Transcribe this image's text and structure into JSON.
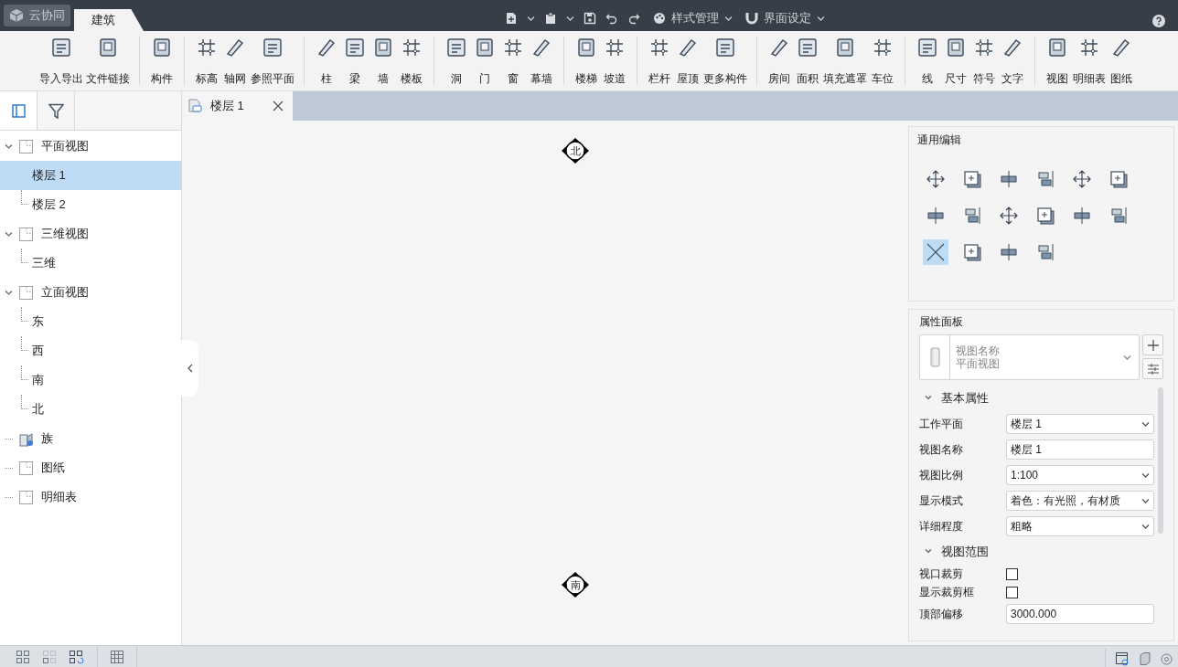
{
  "app_button": {
    "label": "云协同"
  },
  "ribbon_tabs": [
    {
      "label": "建筑",
      "selected": true
    }
  ],
  "quick_menus": [
    {
      "label": "样式管理"
    },
    {
      "label": "界面设定"
    }
  ],
  "ribbon_groups": [
    {
      "buttons": [
        {
          "label": "导入导出"
        },
        {
          "label": "文件链接"
        }
      ]
    },
    {
      "buttons": [
        {
          "label": "构件"
        }
      ]
    },
    {
      "buttons": [
        {
          "label": "标高"
        },
        {
          "label": "轴网"
        },
        {
          "label": "参照平面"
        }
      ]
    },
    {
      "buttons": [
        {
          "label": "柱"
        },
        {
          "label": "梁"
        },
        {
          "label": "墙"
        },
        {
          "label": "楼板"
        }
      ]
    },
    {
      "buttons": [
        {
          "label": "洞"
        },
        {
          "label": "门"
        },
        {
          "label": "窗"
        },
        {
          "label": "幕墙"
        }
      ]
    },
    {
      "buttons": [
        {
          "label": "楼梯"
        },
        {
          "label": "坡道"
        }
      ]
    },
    {
      "buttons": [
        {
          "label": "栏杆"
        },
        {
          "label": "屋顶"
        },
        {
          "label": "更多构件"
        }
      ]
    },
    {
      "buttons": [
        {
          "label": "房间"
        },
        {
          "label": "面积"
        },
        {
          "label": "填充遮罩"
        },
        {
          "label": "车位"
        }
      ]
    },
    {
      "buttons": [
        {
          "label": "线"
        },
        {
          "label": "尺寸"
        },
        {
          "label": "符号"
        },
        {
          "label": "文字"
        }
      ]
    },
    {
      "buttons": [
        {
          "label": "视图"
        },
        {
          "label": "明细表"
        },
        {
          "label": "图纸"
        }
      ]
    }
  ],
  "sidebar": {
    "tabs": [
      {
        "selected": true
      },
      {
        "selected": false
      }
    ],
    "tree": [
      {
        "label": "平面视图",
        "kind": "view",
        "expanded": true,
        "selected": false,
        "children": [
          {
            "label": "楼层 1",
            "selected": true
          },
          {
            "label": "楼层 2",
            "selected": false
          }
        ]
      },
      {
        "label": "三维视图",
        "kind": "view",
        "expanded": true,
        "selected": false,
        "children": [
          {
            "label": "三维",
            "selected": false
          }
        ]
      },
      {
        "label": "立面视图",
        "kind": "view",
        "expanded": true,
        "selected": false,
        "children": [
          {
            "label": "东",
            "selected": false
          },
          {
            "label": "西",
            "selected": false
          },
          {
            "label": "南",
            "selected": false
          },
          {
            "label": "北",
            "selected": false
          }
        ]
      },
      {
        "label": "族",
        "kind": "family",
        "selected": false
      },
      {
        "label": "图纸",
        "kind": "view",
        "selected": false
      },
      {
        "label": "明细表",
        "kind": "view",
        "selected": false
      }
    ]
  },
  "document_tabs": [
    {
      "label": "楼层 1",
      "selected": true
    }
  ],
  "canvas": {
    "markers": [
      {
        "label": "北",
        "kind": "top"
      },
      {
        "label": "南",
        "kind": "bottom"
      }
    ]
  },
  "edit_panel": {
    "title": "通用编辑",
    "tools": [
      {
        "selected": false
      },
      {
        "selected": false
      },
      {
        "selected": false
      },
      {
        "selected": false
      },
      {
        "selected": false
      },
      {
        "selected": false
      },
      {
        "selected": false
      },
      {
        "selected": false
      },
      {
        "selected": false
      },
      {
        "selected": false
      },
      {
        "selected": false
      },
      {
        "selected": false
      },
      {
        "selected": true
      },
      {
        "selected": false
      },
      {
        "selected": false
      },
      {
        "selected": false
      }
    ]
  },
  "properties_panel": {
    "title": "属性面板",
    "type_selector": {
      "line1": "视图名称",
      "line2": "平面视图"
    },
    "sections": [
      {
        "title": "基本属性",
        "expanded": true,
        "rows": [
          {
            "label": "工作平面",
            "kind": "select",
            "value": "楼层 1"
          },
          {
            "label": "视图名称",
            "kind": "text",
            "value": "楼层 1"
          },
          {
            "label": "视图比例",
            "kind": "select",
            "value": "1:100"
          },
          {
            "label": "显示模式",
            "kind": "select",
            "value": "着色：有光照，有材质"
          },
          {
            "label": "详细程度",
            "kind": "select",
            "value": "粗略"
          }
        ]
      },
      {
        "title": "视图范围",
        "expanded": true,
        "rows": [
          {
            "label": "视口裁剪",
            "kind": "checkbox",
            "checked": false
          },
          {
            "label": "显示裁剪框",
            "kind": "checkbox",
            "checked": false
          },
          {
            "label": "顶部偏移",
            "kind": "text",
            "value": "3000.000"
          }
        ]
      }
    ]
  }
}
